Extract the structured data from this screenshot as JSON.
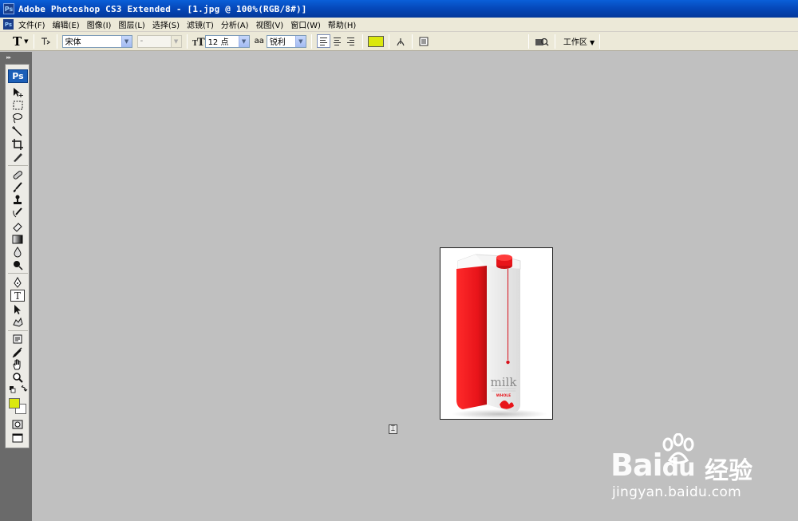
{
  "window": {
    "title": "Adobe Photoshop CS3 Extended - [1.jpg @ 100%(RGB/8#)]",
    "app_icon": "Ps"
  },
  "menubar": {
    "items": [
      "文件(F)",
      "编辑(E)",
      "图像(I)",
      "图层(L)",
      "选择(S)",
      "滤镜(T)",
      "分析(A)",
      "视图(V)",
      "窗口(W)",
      "帮助(H)"
    ]
  },
  "options": {
    "tool_glyph": "T",
    "font_family": "宋体",
    "font_style": "-",
    "font_size": "12 点",
    "aa_label": "aa",
    "antialias": "锐利",
    "text_color": "#dbe80e",
    "workspace_label": "工作区"
  },
  "toolbox": {
    "logo": "Ps",
    "foreground": "#dbe80e",
    "background": "#ffffff"
  },
  "canvas": {
    "product_text": "milk",
    "product_subtext": "WHOLE"
  },
  "watermark": {
    "logo": "Bai",
    "logo_tail": "du",
    "brand_cn": "经验",
    "url": "jingyan.baidu.com"
  },
  "colors": {
    "canvas_bg": "#c0c0c0",
    "carton_red": "#e8141a",
    "titlebar": "#0547b8"
  }
}
